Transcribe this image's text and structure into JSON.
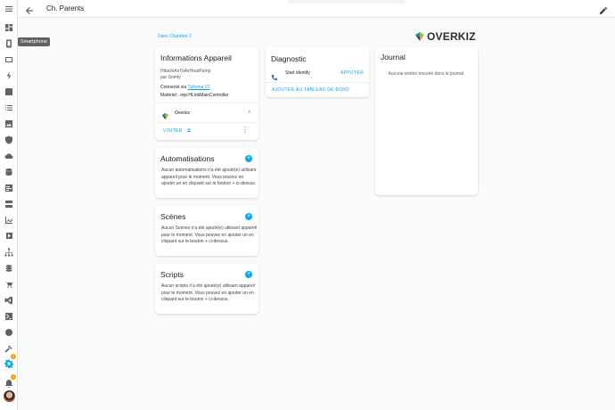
{
  "header": {
    "title": "Ch. Parents"
  },
  "sidebar": {
    "tooltip": "Smartphone",
    "settings_badge": "2",
    "notif_badge": "1"
  },
  "breadcrumb": "Dans Chambre 2",
  "logo": {
    "text": "OVERKIZ"
  },
  "info_card": {
    "title": "Informations Appareil",
    "model": "HitachiAirToAirHeatPump",
    "by": "par Somfy",
    "connected_prefix": "Connecté via ",
    "connected_link": "Tahoma V2",
    "hardware": "Matériel : ovp:HLinkMainController",
    "integration": "Overkiz",
    "visit": "VISITER"
  },
  "automations": {
    "title": "Automatisations",
    "text": "Aucun automatisations n'a été ajouté(e) utilisant appareil pour le moment. Vous pouvez en ajouter un en cliquant sur le bouton + ci-dessus."
  },
  "scenes": {
    "title": "Scènes",
    "text": "Aucun Scènes n'a été ajouté(e) utilisant appareil pour le moment. Vous pouvez en ajouter un en cliquant sur le bouton + ci-dessus."
  },
  "scripts": {
    "title": "Scripts",
    "text": "Aucun scripts n'a été ajouté(e) utilisant appareil pour le moment. Vous pouvez en ajouter un en cliquant sur le bouton + ci-dessus."
  },
  "diagnostic": {
    "title": "Diagnostic",
    "row_label": "Start identify",
    "row_action": "APPUYER",
    "add_dashboard": "AJOUTER AU TABLEAU DE BORD"
  },
  "journal": {
    "title": "Journal",
    "empty": "Aucune entrée trouvée dans le journal."
  },
  "colors": {
    "accent": "#03a9f4",
    "badge": "#ff9800"
  },
  "icons": [
    "menu-icon",
    "dashboard-icon",
    "smartphone-icon",
    "tablet-icon",
    "energy-icon",
    "person-icon",
    "list-icon",
    "tv-icon",
    "image-icon",
    "shield-icon",
    "cloud-icon",
    "database-icon",
    "code-icon",
    "server-icon",
    "chart-icon",
    "media-icon",
    "network-icon",
    "layers-icon",
    "cart-icon",
    "vscode-icon",
    "terminal-icon",
    "compass-icon",
    "hammer-icon",
    "settings-icon",
    "bell-icon"
  ]
}
